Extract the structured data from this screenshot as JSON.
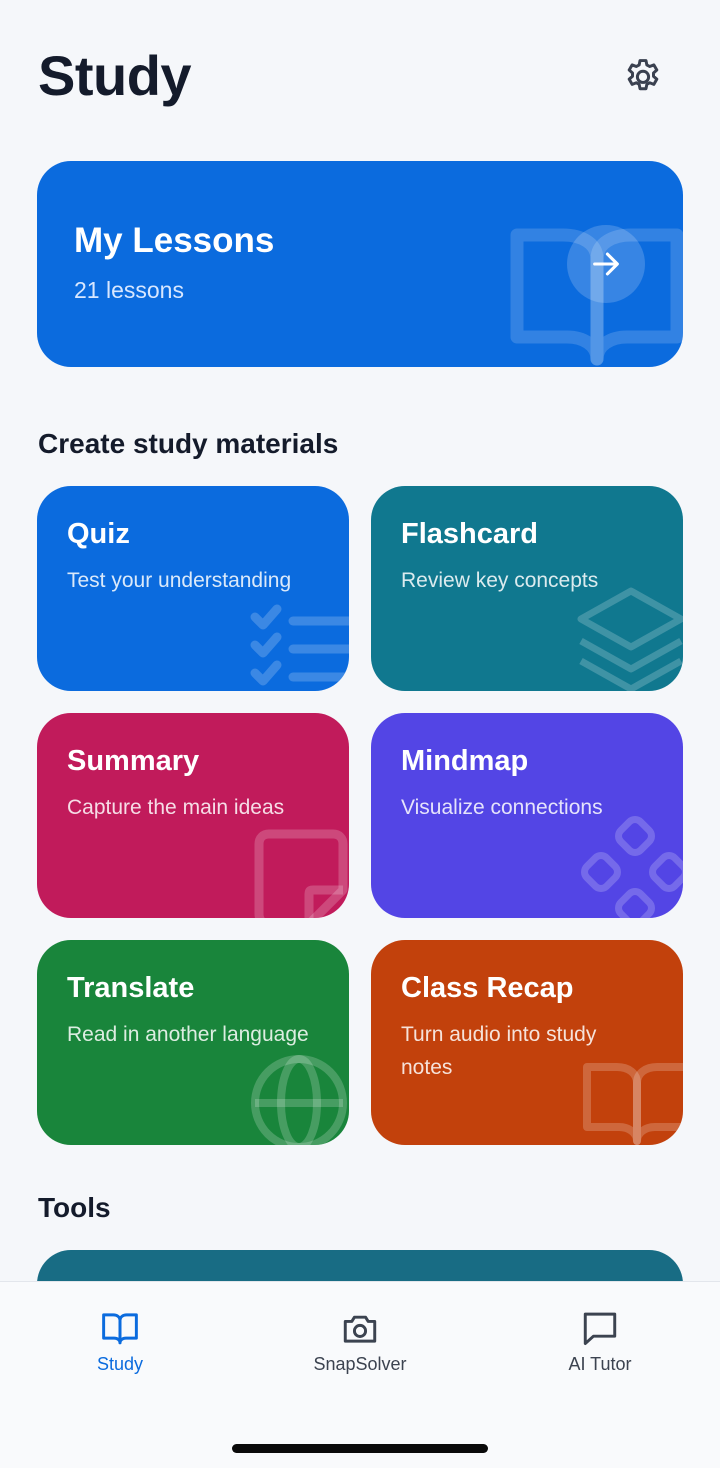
{
  "header": {
    "title": "Study"
  },
  "lessons": {
    "title": "My Lessons",
    "count": "21 lessons"
  },
  "create_section": {
    "title": "Create study materials",
    "cards": [
      {
        "title": "Quiz",
        "subtitle": "Test your understanding",
        "color": "#0b6bde",
        "icon": "checklist-icon"
      },
      {
        "title": "Flashcard",
        "subtitle": "Review key concepts",
        "color": "#10788f",
        "icon": "layers-icon"
      },
      {
        "title": "Summary",
        "subtitle": "Capture the main ideas",
        "color": "#c11b5b",
        "icon": "note-icon"
      },
      {
        "title": "Mindmap",
        "subtitle": "Visualize connections",
        "color": "#5345e5",
        "icon": "nodes-icon"
      },
      {
        "title": "Translate",
        "subtitle": "Read in another language",
        "color": "#19853b",
        "icon": "globe-icon"
      },
      {
        "title": "Class Recap",
        "subtitle": "Turn audio into study notes",
        "color": "#c2410c",
        "icon": "book-icon"
      }
    ]
  },
  "tools_section": {
    "title": "Tools"
  },
  "nav": {
    "items": [
      {
        "label": "Study",
        "icon": "book-icon",
        "active": true
      },
      {
        "label": "SnapSolver",
        "icon": "camera-icon",
        "active": false
      },
      {
        "label": "AI Tutor",
        "icon": "chat-icon",
        "active": false
      }
    ]
  },
  "colors": {
    "accent": "#0b6bde",
    "background": "#f5f7fa",
    "tools_card": "#186c84"
  }
}
